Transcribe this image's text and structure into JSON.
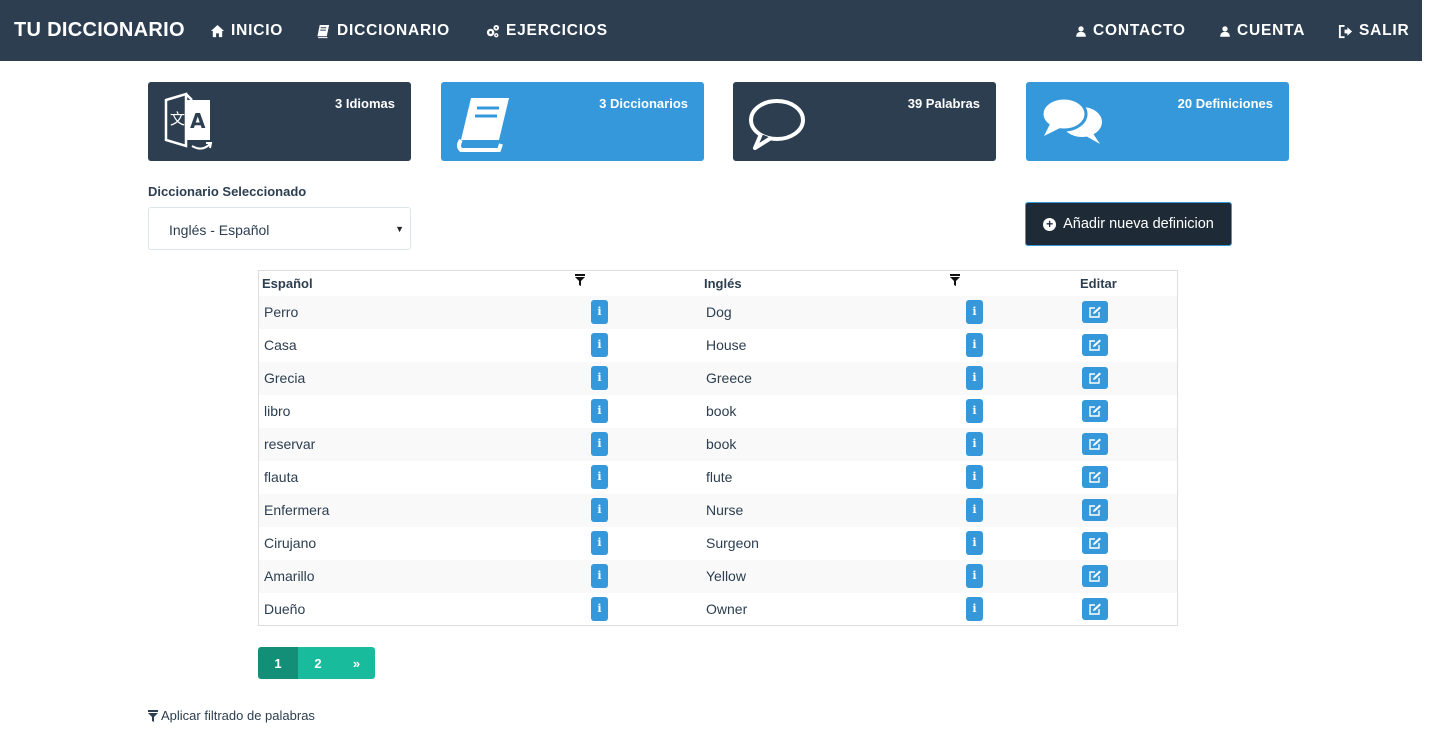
{
  "navbar": {
    "brand": "TU DICCIONARIO",
    "inicio": "INICIO",
    "diccionario": "DICCIONARIO",
    "ejercicios": "EJERCICIOS",
    "contacto": "CONTACTO",
    "cuenta": "CUENTA",
    "salir": "SALIR"
  },
  "stats": {
    "idiomas": "3 Idiomas",
    "diccionarios": "3 Diccionarios",
    "palabras": "39 Palabras",
    "definiciones": "20 Definiciones"
  },
  "selector": {
    "label": "Diccionario Seleccionado",
    "value": "Inglés - Español"
  },
  "add_button": "Añadir nueva definicion",
  "table": {
    "headers": {
      "col1": "Español",
      "col2": "Inglés",
      "col3": "Editar"
    },
    "info_glyph": "i",
    "rows": [
      {
        "es": "Perro",
        "en": "Dog"
      },
      {
        "es": "Casa",
        "en": "House"
      },
      {
        "es": "Grecia",
        "en": "Greece"
      },
      {
        "es": "libro",
        "en": "book"
      },
      {
        "es": "reservar",
        "en": "book"
      },
      {
        "es": "flauta",
        "en": "flute"
      },
      {
        "es": "Enfermera",
        "en": "Nurse"
      },
      {
        "es": "Cirujano",
        "en": "Surgeon"
      },
      {
        "es": "Amarillo",
        "en": "Yellow"
      },
      {
        "es": "Dueño",
        "en": "Owner"
      }
    ]
  },
  "pagination": {
    "p1": "1",
    "p2": "2",
    "next": "»"
  },
  "filter_link": "Aplicar filtrado de palabras",
  "colors": {
    "navy": "#2c3e50",
    "blue": "#3498db",
    "teal": "#18bc9c",
    "teal_active": "#128f76"
  },
  "icons": {
    "inicio": "home-icon",
    "diccionario": "book-icon",
    "ejercicios": "cogs-icon",
    "contacto": "user-icon",
    "cuenta": "user-icon",
    "salir": "sign-out-icon",
    "idiomas": "translate-icon",
    "diccionarios": "book-icon",
    "palabras": "comment-icon",
    "definiciones": "comments-icon"
  }
}
